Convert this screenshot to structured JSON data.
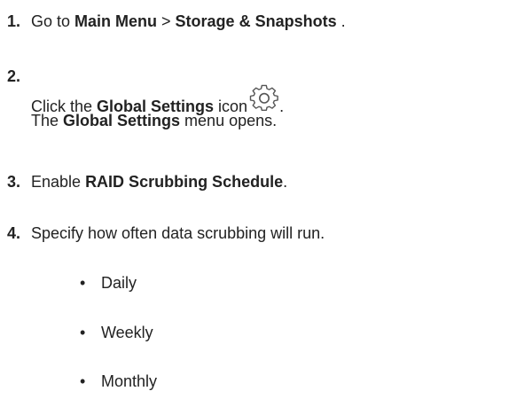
{
  "steps": [
    {
      "number": "1.",
      "parts": [
        "Go to ",
        "Main Menu",
        " > ",
        "Storage & Snapshots",
        " ."
      ]
    },
    {
      "number": "2.",
      "line1": [
        "Click the ",
        "Global Settings",
        " icon",
        "."
      ],
      "line2": [
        "The ",
        "Global Settings",
        " menu opens."
      ]
    },
    {
      "number": "3.",
      "parts": [
        "Enable ",
        "RAID Scrubbing Schedule",
        "."
      ]
    },
    {
      "number": "4.",
      "parts": [
        "Specify how often data scrubbing will run."
      ]
    }
  ],
  "frequency_options": [
    {
      "bullet": "•",
      "label": "Daily"
    },
    {
      "bullet": "•",
      "label": "Weekly"
    },
    {
      "bullet": "•",
      "label": "Monthly"
    }
  ],
  "icons": {
    "global_settings": "gear-icon"
  },
  "colors": {
    "text": "#222222",
    "icon_stroke": "#555555"
  }
}
